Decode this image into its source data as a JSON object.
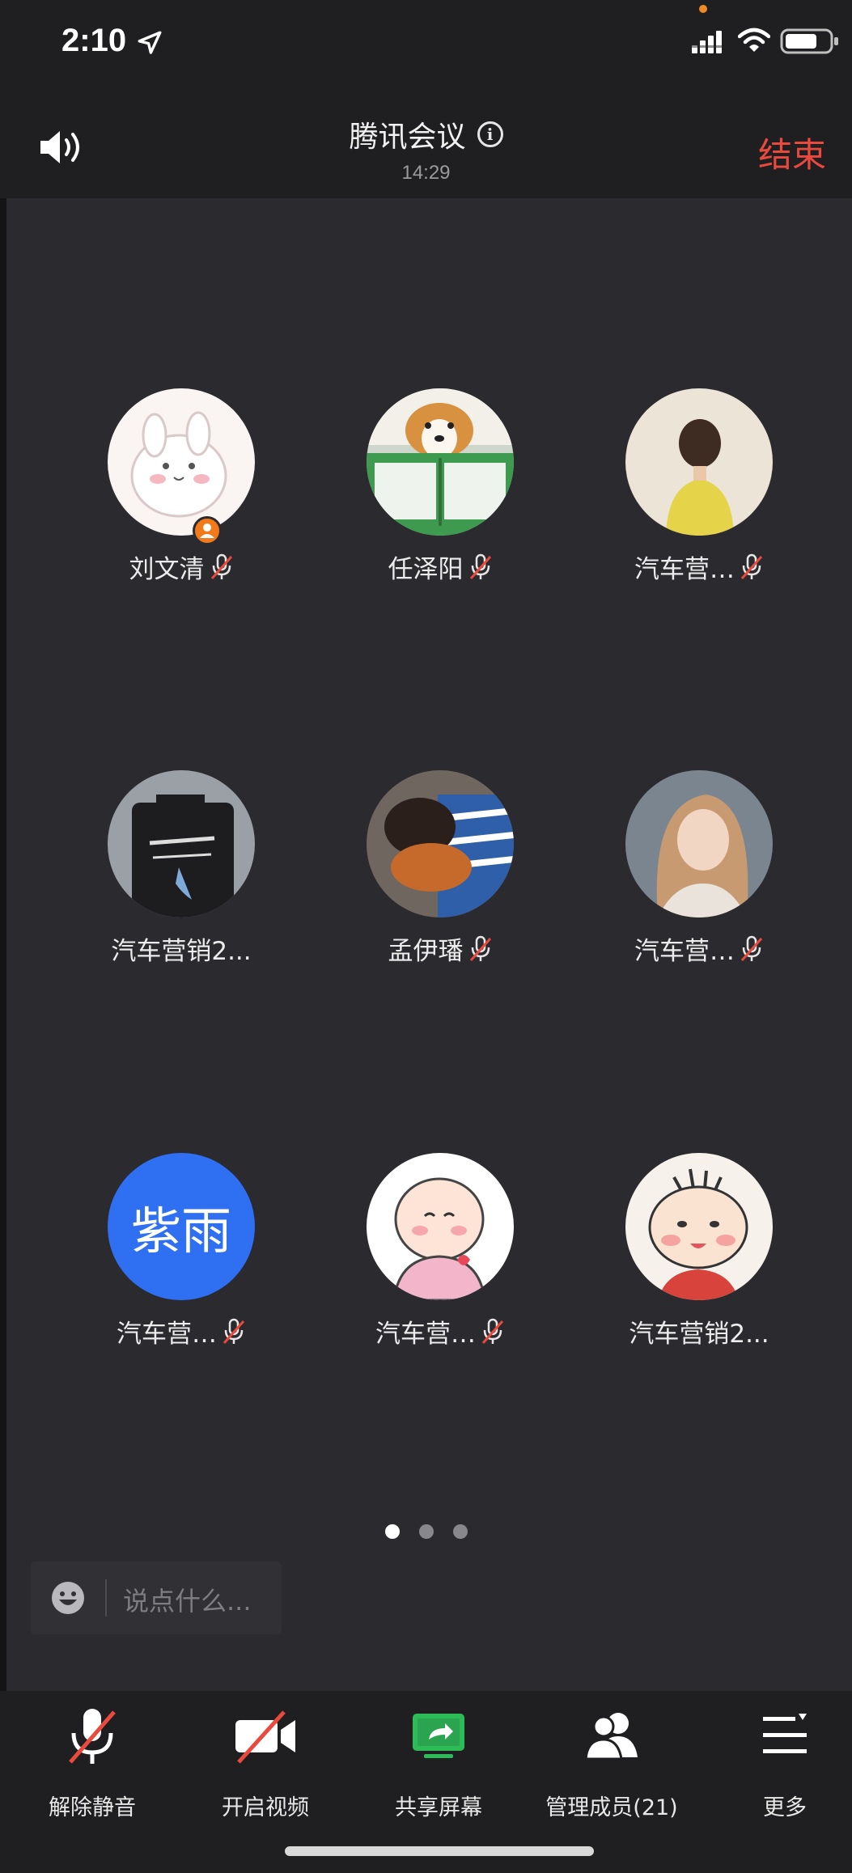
{
  "status_bar": {
    "time": "2:10"
  },
  "header": {
    "title": "腾讯会议",
    "duration": "14:29",
    "end_label": "结束"
  },
  "participants": [
    {
      "name": "刘文清",
      "muted": true,
      "host": true
    },
    {
      "name": "任泽阳",
      "muted": true,
      "host": false
    },
    {
      "name": "汽车营…",
      "muted": true,
      "host": false
    },
    {
      "name": "汽车营销2...",
      "muted": false,
      "host": false
    },
    {
      "name": "孟伊璠",
      "muted": true,
      "host": false
    },
    {
      "name": "汽车营…",
      "muted": true,
      "host": false
    },
    {
      "name": "汽车营…",
      "muted": true,
      "host": false,
      "avatar_text": "紫雨"
    },
    {
      "name": "汽车营…",
      "muted": true,
      "host": false
    },
    {
      "name": "汽车营销2...",
      "muted": false,
      "host": false
    }
  ],
  "pagination": {
    "pages": 3,
    "current": 1
  },
  "chat": {
    "placeholder": "说点什么..."
  },
  "toolbar": {
    "unmute_label": "解除静音",
    "video_label": "开启视频",
    "share_label": "共享屏幕",
    "members_label": "管理成员(21)",
    "more_label": "更多"
  },
  "colors": {
    "accent_red": "#ea4a3e",
    "share_green": "#2dbb58",
    "host_orange": "#f27a1a",
    "avatar_blue": "#2f6ff2"
  }
}
